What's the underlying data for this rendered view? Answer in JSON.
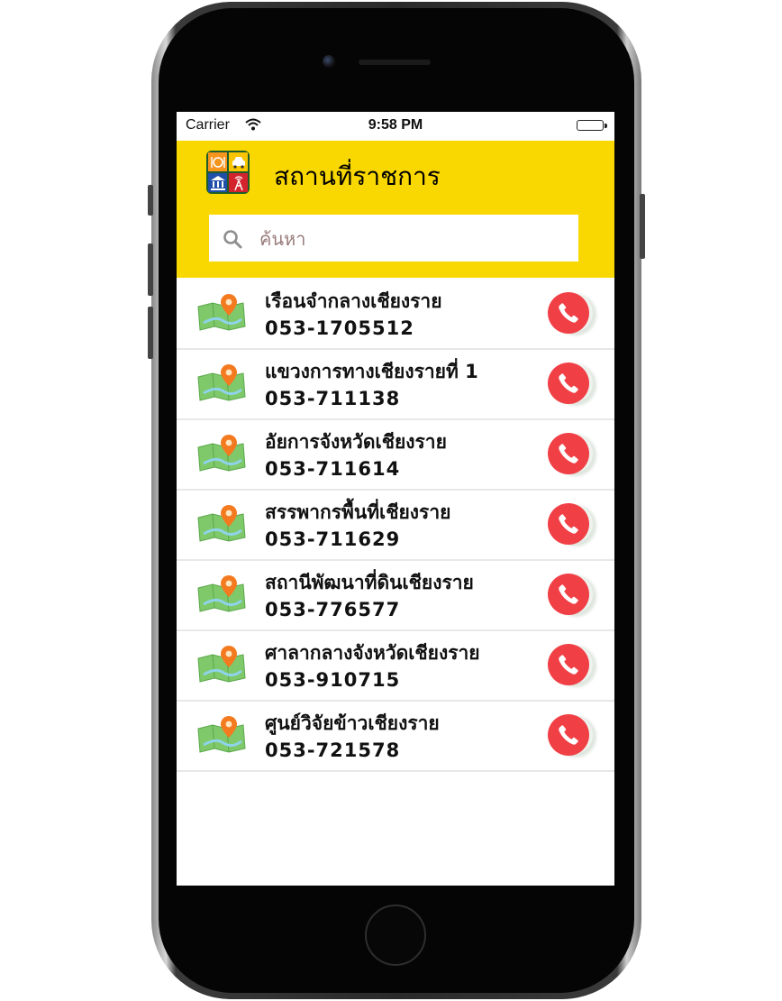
{
  "status_bar": {
    "carrier": "Carrier",
    "time": "9:58 PM"
  },
  "header": {
    "title": "สถานที่ราชการ",
    "background_color": "#f9d700"
  },
  "search": {
    "placeholder": "ค้นหา",
    "value": ""
  },
  "call_button_color": "#f04046",
  "places": [
    {
      "name": "เรือนจำกลางเชียงราย",
      "phone": "053-1705512"
    },
    {
      "name": "แขวงการทางเชียงรายที่ 1",
      "phone": "053-711138"
    },
    {
      "name": "อัยการจังหวัดเชียงราย",
      "phone": "053-711614"
    },
    {
      "name": "สรรพากรพื้นที่เชียงราย",
      "phone": "053-711629"
    },
    {
      "name": "สถานีพัฒนาที่ดินเชียงราย",
      "phone": "053-776577"
    },
    {
      "name": "ศาลากลางจังหวัดเชียงราย",
      "phone": "053-910715"
    },
    {
      "name": "ศูนย์วิจัยข้าวเชียงราย",
      "phone": "053-721578"
    }
  ]
}
